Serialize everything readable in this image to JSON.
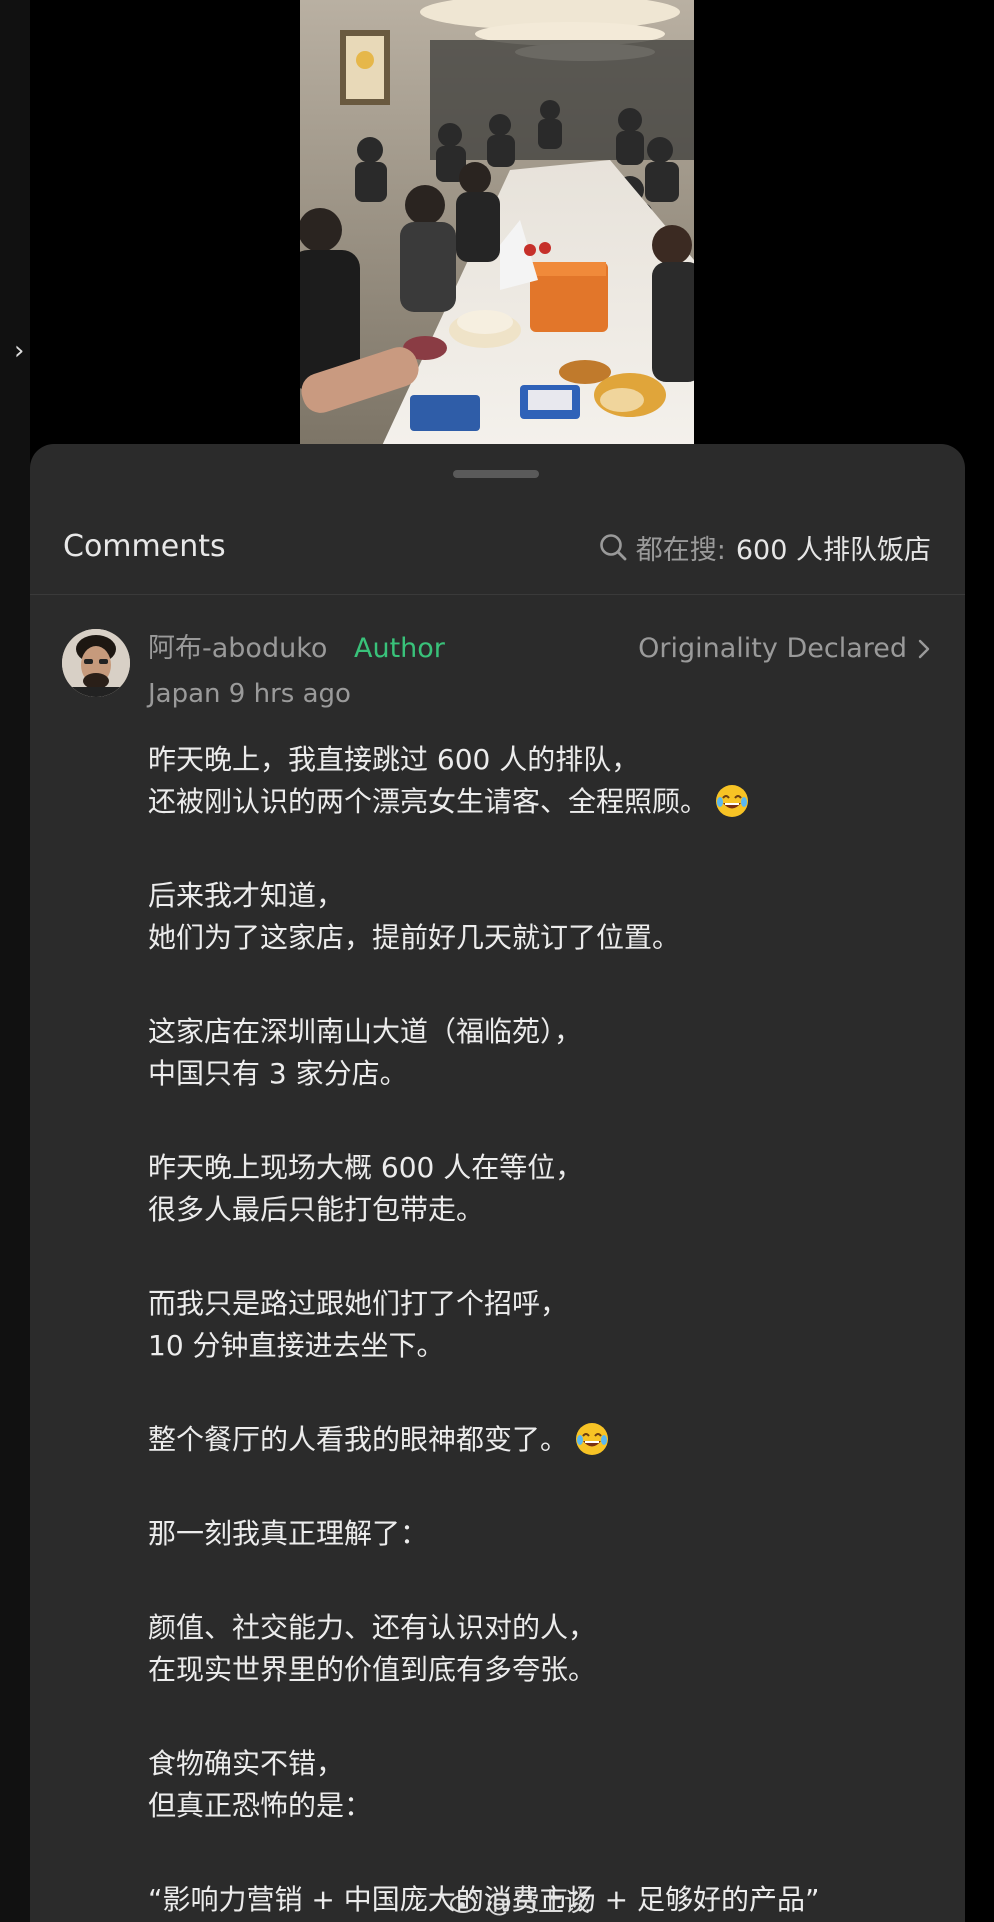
{
  "sheet": {
    "title": "Comments",
    "search": {
      "prefix": "都在搜:",
      "query": "600 人排队饭店"
    }
  },
  "comment": {
    "username": "阿布-aboduko",
    "badge": "Author",
    "originality": "Originality Declared",
    "meta": "Japan 9 hrs ago",
    "paragraphs": {
      "p1": {
        "l1": "昨天晚上，我直接跳过 600 人的排队，",
        "l2": "还被刚认识的两个漂亮女生请客、全程照顾。"
      },
      "p2": {
        "l1": "后来我才知道，",
        "l2": "她们为了这家店，提前好几天就订了位置。"
      },
      "p3": {
        "l1": "这家店在深圳南山大道（福临苑），",
        "l2": "中国只有 3 家分店。"
      },
      "p4": {
        "l1": "昨天晚上现场大概 600 人在等位，",
        "l2": "很多人最后只能打包带走。"
      },
      "p5": {
        "l1": "而我只是路过跟她们打了个招呼，",
        "l2": "10 分钟直接进去坐下。"
      },
      "p6": {
        "l1": "整个餐厅的人看我的眼神都变了。"
      },
      "p7": {
        "l1": "那一刻我真正理解了："
      },
      "p8": {
        "l1": "颜值、社交能力、还有认识对的人，",
        "l2": "在现实世界里的价值到底有多夸张。"
      },
      "p9": {
        "l1": "食物确实不错，",
        "l2": "但真正恐怖的是："
      },
      "p10": {
        "l1": "“影响力营销 + 中国庞大的消费市场 + 足够好的产品”"
      }
    }
  },
  "watermark": "@马上谈",
  "icons": {
    "emoji": "face-with-tears-of-joy-icon",
    "search": "search-icon",
    "chevron": "chevron-right-icon"
  },
  "colors": {
    "background": "#000000",
    "sheet": "#2b2b2b",
    "author_badge": "#39c27a",
    "muted_text": "#9a9a9a",
    "body_text": "#ececec"
  }
}
